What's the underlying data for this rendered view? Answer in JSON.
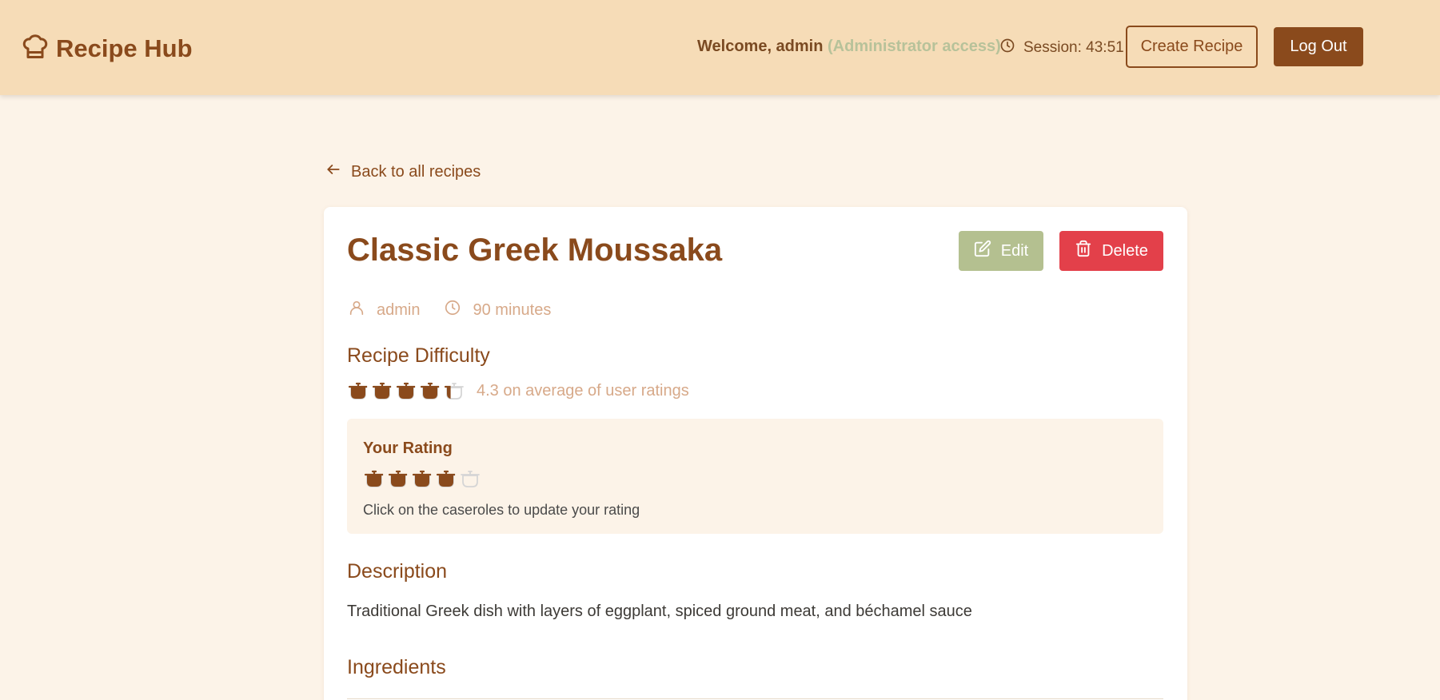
{
  "header": {
    "brand": "Recipe Hub",
    "welcome_prefix": "Welcome, admin",
    "admin_access": "(Administrator access)",
    "session": "Session: 43:51",
    "create_label": "Create Recipe",
    "logout_label": "Log Out"
  },
  "nav": {
    "back_label": "Back to all recipes"
  },
  "recipe": {
    "title": "Classic Greek Moussaka",
    "edit_label": "Edit",
    "delete_label": "Delete",
    "author": "admin",
    "time": "90 minutes",
    "difficulty_heading": "Recipe Difficulty",
    "average_rating": 4.3,
    "average_text": "4.3 on average of user ratings",
    "your_rating_heading": "Your Rating",
    "your_rating": 4,
    "rating_max": 5,
    "rating_hint": "Click on the caseroles to update your rating",
    "description_heading": "Description",
    "description": "Traditional Greek dish with layers of eggplant, spiced ground meat, and béchamel sauce",
    "ingredients_heading": "Ingredients"
  },
  "colors": {
    "brand": "#8a4a1c",
    "header_bg": "#f6dcb7",
    "page_bg": "#fcf3e8",
    "admin_access": "#b7c29a",
    "edit": "#b4c090",
    "delete": "#e3404a",
    "muted": "#d7a989",
    "pot_empty": "#d5d5d5"
  },
  "icons": {
    "brand": "chef-hat-icon",
    "session": "clock-icon",
    "back": "arrow-left-icon",
    "edit": "pencil-square-icon",
    "delete": "trash-icon",
    "author": "user-icon",
    "time": "clock-icon",
    "rating": "casserole-icon"
  }
}
